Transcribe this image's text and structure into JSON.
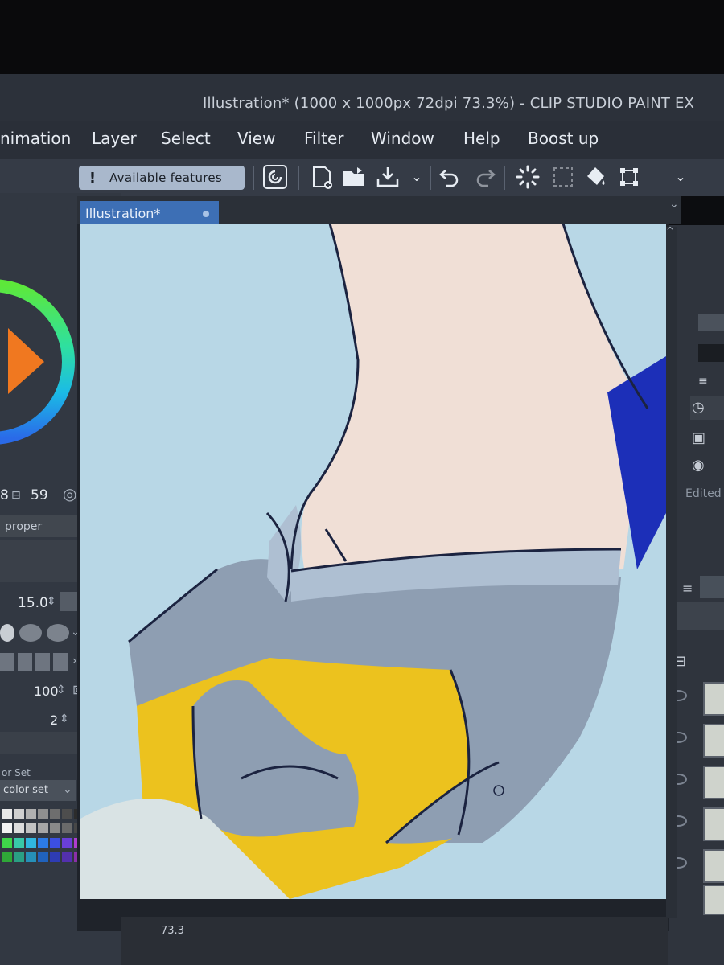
{
  "window": {
    "title": "Illustration* (1000 x 1000px 72dpi 73.3%) - CLIP STUDIO PAINT EX"
  },
  "menu": {
    "items": [
      "nimation",
      "Layer",
      "Select",
      "View",
      "Filter",
      "Window",
      "Help",
      "Boost up"
    ]
  },
  "toolbar": {
    "available_features": "Available features",
    "icons": [
      "companion-icon",
      "new-file-icon",
      "open-folder-icon",
      "save-icon",
      "undo-icon",
      "redo-icon",
      "loading-icon",
      "transparent-icon",
      "fill-icon",
      "transform-icon"
    ]
  },
  "tabs": {
    "document": "Illustration*"
  },
  "left_panel": {
    "brush_counter_a": "8",
    "brush_counter_b": "59",
    "property_tab": "proper",
    "brush_size": "15.0",
    "opacity": "100",
    "stabilization": "2",
    "color_set_header": "or Set",
    "color_set_name": "color set"
  },
  "right_panel": {
    "layer_label": "Edited"
  },
  "status": {
    "zoom": "73.3"
  },
  "colors": {
    "sky": "#b8d7e6",
    "skin": "#f0dfd6",
    "shirt": "#8e9eb2",
    "collar": "#aebfd2",
    "yellow": "#ecc21e",
    "cloth_blue": "#1c2fb8",
    "ink": "#1b2340",
    "accent_tab": "#3d6fb5"
  }
}
